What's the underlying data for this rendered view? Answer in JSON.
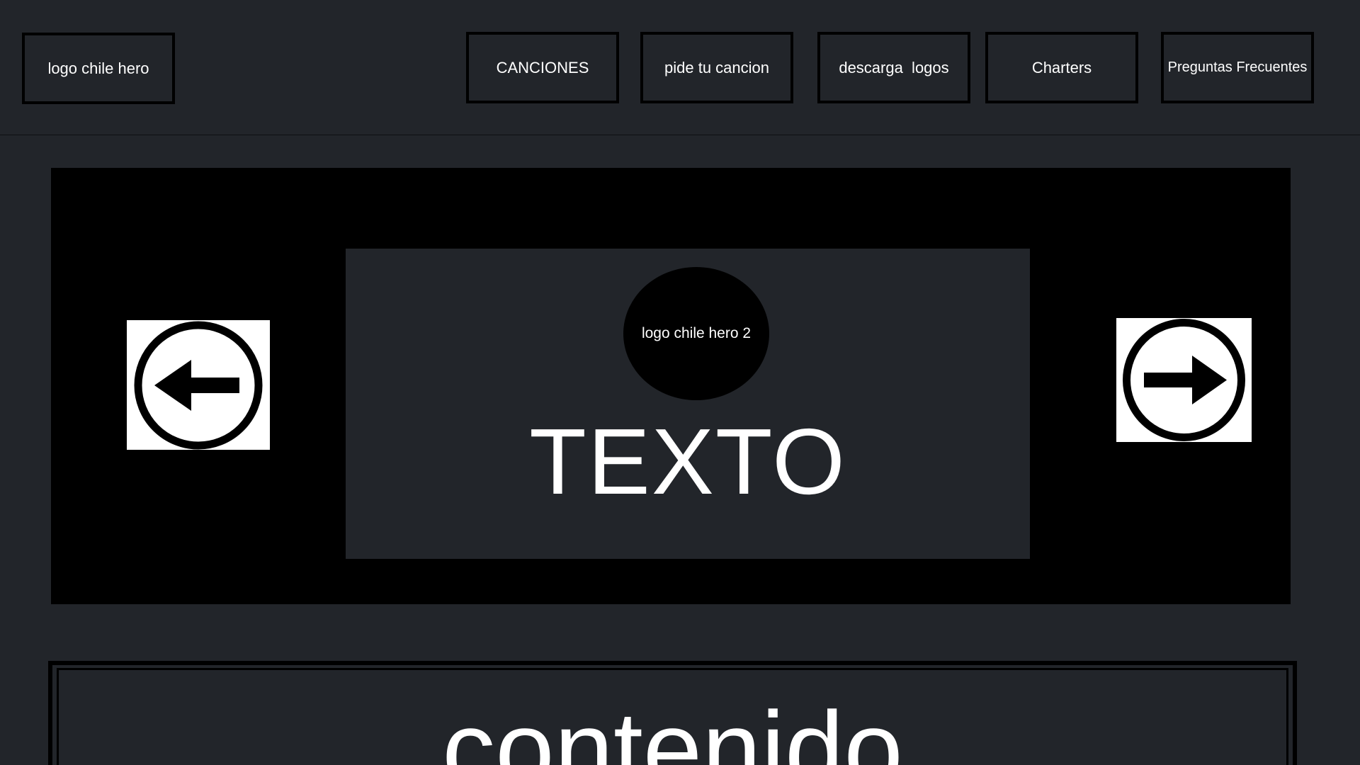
{
  "header": {
    "logo_label": "logo chile hero",
    "nav": [
      {
        "label": "CANCIONES"
      },
      {
        "label": "pide tu cancion"
      },
      {
        "label": "descarga  logos"
      },
      {
        "label": "Charters"
      },
      {
        "label": "Preguntas Frecuentes"
      }
    ]
  },
  "hero": {
    "logo_label": "logo chile hero 2",
    "text": "TEXTO",
    "prev_icon": "arrow-left-circle-icon",
    "next_icon": "arrow-right-circle-icon"
  },
  "content": {
    "text": "contenido"
  },
  "colors": {
    "background": "#22252a",
    "hero_background": "#000000",
    "border": "#000000",
    "text": "#ffffff"
  }
}
